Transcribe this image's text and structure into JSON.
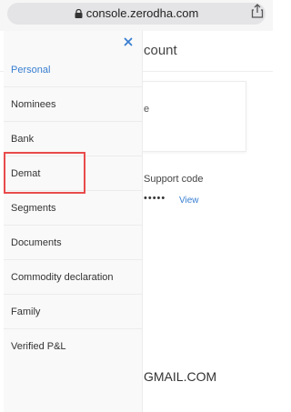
{
  "browser": {
    "url": "console.zerodha.com",
    "lock_icon": "lock-icon",
    "share_icon": "share-icon"
  },
  "background": {
    "title_fragment": "count",
    "card_text": "e",
    "support_code_label": "Support code",
    "masked_value": "•••••",
    "view_label": "View",
    "email_fragment": "GMAIL.COM"
  },
  "sidebar": {
    "close_icon": "close-icon",
    "items": [
      {
        "label": "Personal",
        "active": true
      },
      {
        "label": "Nominees"
      },
      {
        "label": "Bank"
      },
      {
        "label": "Demat"
      },
      {
        "label": "Segments"
      },
      {
        "label": "Documents"
      },
      {
        "label": "Commodity declaration"
      },
      {
        "label": "Family"
      },
      {
        "label": "Verified P&L"
      }
    ]
  },
  "colors": {
    "accent": "#387ed1",
    "highlight_border": "#e94b4b"
  }
}
